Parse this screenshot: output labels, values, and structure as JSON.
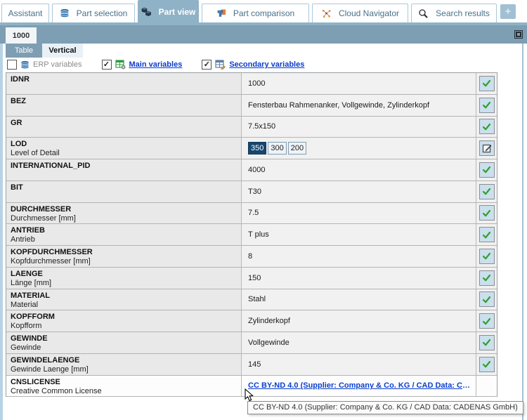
{
  "top_tabs": [
    {
      "label": "Assistant",
      "icon": null,
      "active": false
    },
    {
      "label": "Part selection",
      "icon": "database-icon",
      "active": false
    },
    {
      "label": "Part view",
      "icon": "cubes-icon",
      "active": true
    },
    {
      "label": "Part comparison",
      "icon": "compare-parts-icon",
      "active": false
    },
    {
      "label": "Cloud Navigator",
      "icon": "network-icon",
      "active": false
    },
    {
      "label": "Search results",
      "icon": "magnifier-icon",
      "active": false
    }
  ],
  "add_tab_button": "+",
  "document_tab": {
    "label": "1000"
  },
  "view_tabs": [
    {
      "label": "Table",
      "active": false
    },
    {
      "label": "Vertical",
      "active": true
    }
  ],
  "variable_filters": [
    {
      "label": "ERP variables",
      "checked": false,
      "icon": "erp-database-icon",
      "link": false
    },
    {
      "label": "Main variables",
      "checked": true,
      "icon": "main-variables-table-icon",
      "link": true
    },
    {
      "label": "Secondary variables",
      "checked": true,
      "icon": "secondary-variables-table-icon",
      "link": true
    }
  ],
  "rows": [
    {
      "name": "IDNR",
      "sublabel": "",
      "type": "text",
      "value": "1000",
      "action": "check"
    },
    {
      "name": "BEZ",
      "sublabel": "",
      "type": "text",
      "value": "Fensterbau Rahmenanker, Vollgewinde, Zylinderkopf",
      "action": "check"
    },
    {
      "name": "GR",
      "sublabel": "",
      "type": "text",
      "value": "7.5x150",
      "action": "check"
    },
    {
      "name": "LOD",
      "sublabel": "Level of Detail",
      "type": "lod",
      "options": [
        "350",
        "300",
        "200"
      ],
      "selected": "350",
      "action": "edit"
    },
    {
      "name": "INTERNATIONAL_PID",
      "sublabel": "",
      "type": "text",
      "value": "4000",
      "action": "check"
    },
    {
      "name": "BIT",
      "sublabel": "",
      "type": "text",
      "value": "T30",
      "action": "check"
    },
    {
      "name": "DURCHMESSER",
      "sublabel": "Durchmesser [mm]",
      "type": "text",
      "value": "7.5",
      "action": "check"
    },
    {
      "name": "ANTRIEB",
      "sublabel": "Antrieb",
      "type": "text",
      "value": "T plus",
      "action": "check"
    },
    {
      "name": "KOPFDURCHMESSER",
      "sublabel": "Kopfdurchmesser [mm]",
      "type": "text",
      "value": "8",
      "action": "check"
    },
    {
      "name": "LAENGE",
      "sublabel": "Länge [mm]",
      "type": "text",
      "value": "150",
      "action": "check"
    },
    {
      "name": "MATERIAL",
      "sublabel": "Material",
      "type": "text",
      "value": "Stahl",
      "action": "check"
    },
    {
      "name": "KOPFFORM",
      "sublabel": "Kopfform",
      "type": "text",
      "value": "Zylinderkopf",
      "action": "check"
    },
    {
      "name": "GEWINDE",
      "sublabel": "Gewinde",
      "type": "text",
      "value": "Vollgewinde",
      "action": "check"
    },
    {
      "name": "GEWINDELAENGE",
      "sublabel": "Gewinde Laenge [mm]",
      "type": "text",
      "value": "145",
      "action": "check"
    },
    {
      "name": "CNSLICENSE",
      "sublabel": "Creative Common License",
      "type": "link",
      "value": "CC BY-ND 4.0 (Supplier: Company & Co. KG / CAD Data: CADENAS GmbH)",
      "action": "none",
      "highlighted": true
    }
  ],
  "tooltip": {
    "text": "CC BY-ND 4.0 (Supplier: Company & Co. KG / CAD Data: CADENAS GmbH)"
  },
  "colors": {
    "accent_bar": "#8fb2c6",
    "doc_bar": "#7d9eb3",
    "link_blue": "#0a3fd0",
    "check_green": "#2da12d",
    "lod_selected": "#17466e"
  }
}
